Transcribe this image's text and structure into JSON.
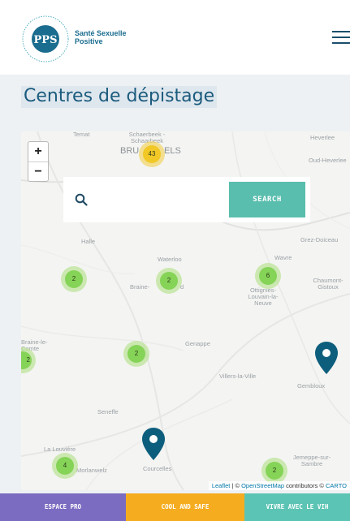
{
  "header": {
    "brand_line1": "Santé Sexuelle",
    "brand_line2": "Positive",
    "logo_monogram": "PPS",
    "logo_ring_text": "PLATEFORME · PRÉVENTION · SIDA"
  },
  "page": {
    "title": "Centres de dépistage"
  },
  "map": {
    "zoom_in": "+",
    "zoom_out": "−",
    "search": {
      "placeholder": "",
      "button": "SEARCH"
    },
    "places": {
      "temat": "Temat",
      "schaerbeek": "Schaerbeek - Schaarbeek",
      "bruxelles_a": "BRU",
      "bruxelles_b": "ELS",
      "heverlee": "Heverlee",
      "oud_heverlee": "Oud-Heverlee",
      "halle": "Halle",
      "grez": "Grez-Doiceau",
      "waterloo": "Waterloo",
      "wavre": "Wavre",
      "braine_a": "Braine-",
      "braine_b": "d",
      "ottignies": "Ottignies-Louvain-la-Neuve",
      "chaumont": "Chaumont-Gistoux",
      "braine_le_comte": "Braine-le-Comte",
      "genappe": "Genappe",
      "villers": "Villers-la-Ville",
      "gembloux": "Gembloux",
      "seneffe": "Seneffe",
      "la_louviere": "La Louvière",
      "morlanwelz": "Morlanwelz",
      "courcelles": "Courcelles",
      "jemeppe": "Jemeppe-sur-Sambre"
    },
    "clusters": {
      "brussels": "43",
      "halle": "2",
      "braine": "2",
      "wavre": "6",
      "braine_le_comte": "2",
      "genappe": "2",
      "la_louviere": "4",
      "jemeppe": "2"
    },
    "attribution": {
      "leaflet": "Leaflet",
      "separator": " | © ",
      "osm": "OpenStreetMap",
      "contributors": " contributors © ",
      "carto": "CARTO"
    }
  },
  "footer": {
    "links": [
      {
        "label": "ESPACE PRO",
        "color": "#7b6bc1"
      },
      {
        "label": "COOL AND SAFE",
        "color": "#f5ac1f"
      },
      {
        "label": "VIVRE AVEC LE VIH",
        "color": "#5cc4b4"
      }
    ]
  },
  "colors": {
    "title_blue": "#1b5b7d",
    "search_teal": "#5abeae",
    "pin_blue": "#0d5e7c",
    "cluster_green": "#6ecc39",
    "cluster_yellow": "#f0c20c"
  }
}
